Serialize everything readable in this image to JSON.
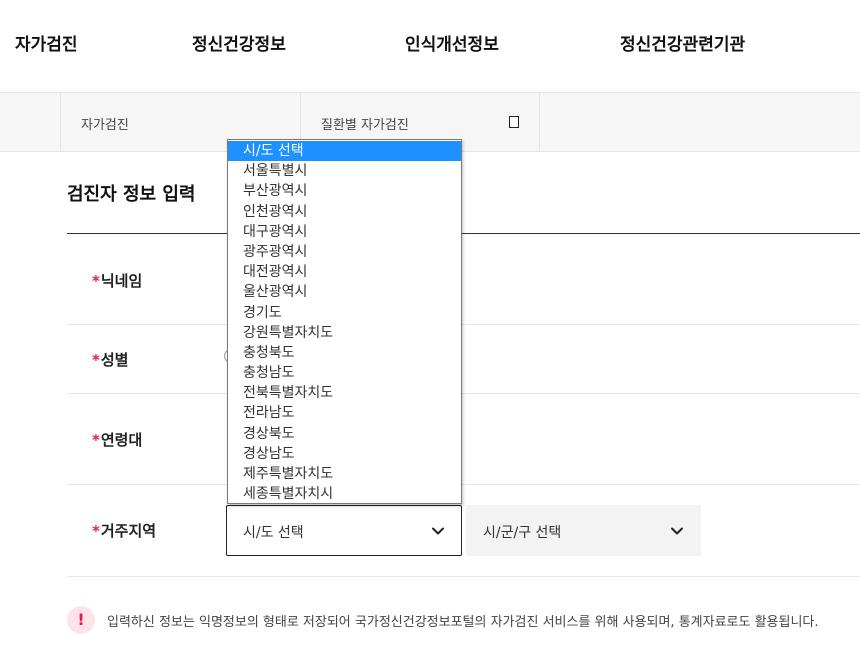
{
  "nav": {
    "items": [
      {
        "label": "자가검진"
      },
      {
        "label": "정신건강정보"
      },
      {
        "label": "인식개선정보"
      },
      {
        "label": "정신건강관련기관"
      }
    ]
  },
  "breadcrumb": {
    "level1": "자가검진",
    "level2": "질환별 자가검진"
  },
  "section": {
    "title": "검진자 정보 입력"
  },
  "form": {
    "required_mark": "*",
    "nickname_label": "닉네임",
    "gender_label": "성별",
    "agegroup_label": "연령대",
    "region_label": "거주지역",
    "sido_select_value": "시/도 선택",
    "sigungu_select_value": "시/군/구 선택"
  },
  "dropdown": {
    "selected_index": 0,
    "options": [
      "시/도 선택",
      "서울특별시",
      "부산광역시",
      "인천광역시",
      "대구광역시",
      "광주광역시",
      "대전광역시",
      "울산광역시",
      "경기도",
      "강원특별자치도",
      "충청북도",
      "충청남도",
      "전북특별자치도",
      "전라남도",
      "경상북도",
      "경상남도",
      "제주특별자치도",
      "세종특별자치시"
    ]
  },
  "notice": {
    "icon": "exclamation-icon",
    "symbol": "!",
    "text": "입력하신 정보는 익명정보의 형태로 저장되어 국가정신건강정보포털의 자가검진 서비스를 위해 사용되며, 통계자료로도 활용됩니다."
  },
  "colors": {
    "required": "#e0204a",
    "selected_option": "#1e90ff"
  }
}
